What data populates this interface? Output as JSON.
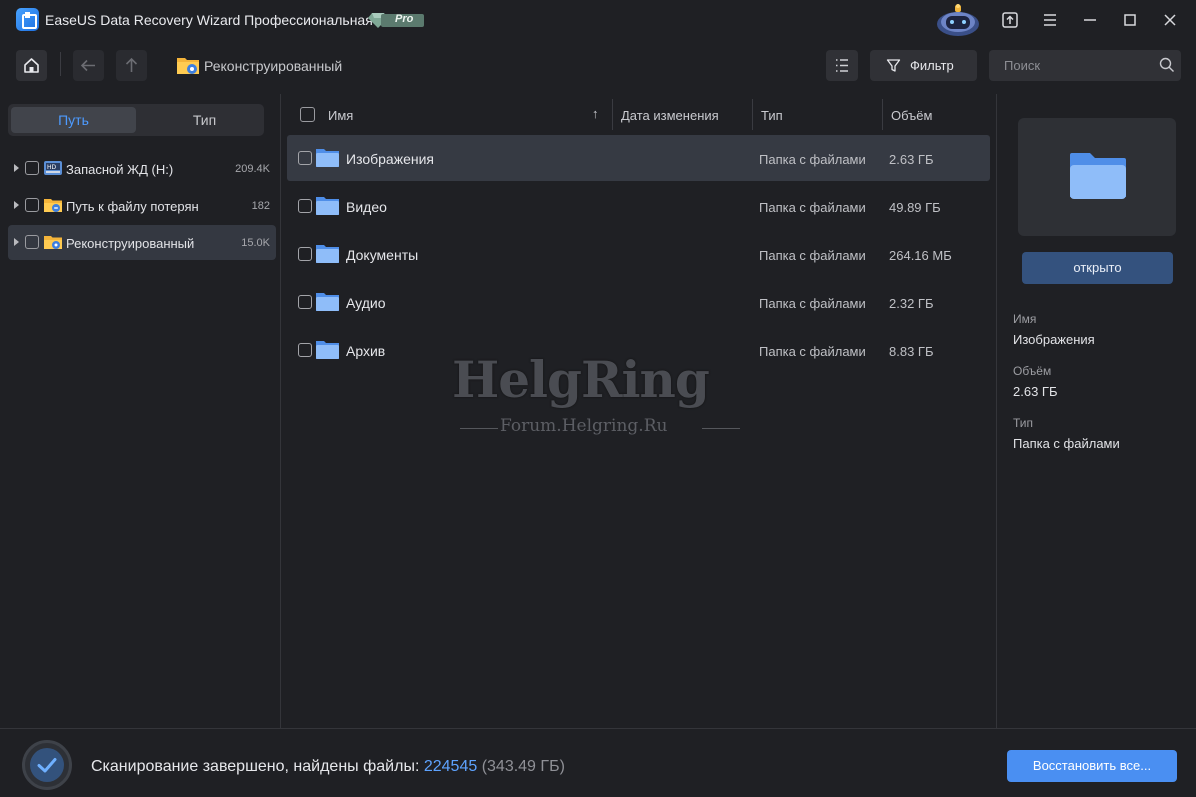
{
  "app": {
    "title": "EaseUS Data Recovery Wizard Профессиональная",
    "badge": "Pro"
  },
  "toolbar": {
    "breadcrumb": "Реконструированный",
    "filter_label": "Фильтр",
    "search_placeholder": "Поиск"
  },
  "sidebar": {
    "tabs": [
      {
        "label": "Путь",
        "active": true
      },
      {
        "label": "Тип",
        "active": false
      }
    ],
    "items": [
      {
        "label": "Запасной ЖД (H:)",
        "count": "209.4K",
        "icon": "drive-icon"
      },
      {
        "label": "Путь к файлу потерян",
        "count": "182",
        "icon": "lost-folder-icon"
      },
      {
        "label": "Реконструированный",
        "count": "15.0K",
        "icon": "reconstructed-folder-icon"
      }
    ]
  },
  "table": {
    "columns": [
      "Имя",
      "Дата изменения",
      "Тип",
      "Объём"
    ],
    "rows": [
      {
        "name": "Изображения",
        "modified": "",
        "type": "Папка с файлами",
        "size": "2.63 ГБ"
      },
      {
        "name": "Видео",
        "modified": "",
        "type": "Папка с файлами",
        "size": "49.89 ГБ"
      },
      {
        "name": "Документы",
        "modified": "",
        "type": "Папка с файлами",
        "size": "264.16 МБ"
      },
      {
        "name": "Аудио",
        "modified": "",
        "type": "Папка с файлами",
        "size": "2.32 ГБ"
      },
      {
        "name": "Архив",
        "modified": "",
        "type": "Папка с файлами",
        "size": "8.83 ГБ"
      }
    ]
  },
  "watermark": {
    "title": "HelgRing",
    "subtitle": "Forum.Helgring.Ru"
  },
  "details": {
    "open_label": "открыто",
    "name_label": "Имя",
    "name_value": "Изображения",
    "size_label": "Объём",
    "size_value": "2.63 ГБ",
    "type_label": "Тип",
    "type_value": "Папка с файлами"
  },
  "status": {
    "text": "Сканирование завершено, найдены файлы:",
    "count": "224545",
    "size": "(343.49 ГБ)",
    "recover_label": "Восстановить все..."
  },
  "colors": {
    "accent": "#4a8ff2",
    "background": "#1f2024",
    "selected_row": "#363a43"
  }
}
